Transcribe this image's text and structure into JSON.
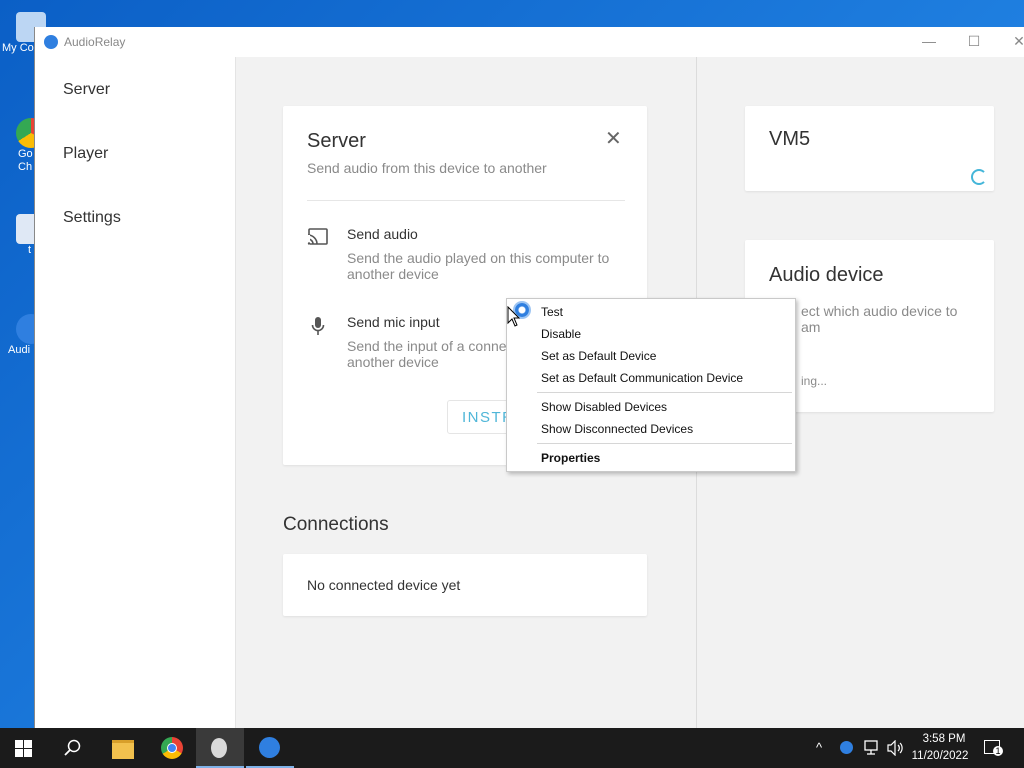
{
  "desktop": {
    "icons": [
      {
        "label": "My Co",
        "name": "my-computer-icon"
      },
      {
        "label": "Go Ch",
        "name": "chrome-desktop-icon"
      },
      {
        "label": "t",
        "name": "file-desktop-icon"
      },
      {
        "label": "Audi",
        "name": "audiorelay-desktop-icon"
      }
    ]
  },
  "window": {
    "title": "AudioRelay",
    "minimize_icon": "—",
    "maximize_icon": "☐",
    "close_icon": "✕"
  },
  "sidebar": {
    "items": [
      {
        "label": "Server"
      },
      {
        "label": "Player"
      },
      {
        "label": "Settings"
      }
    ]
  },
  "server_card": {
    "title": "Server",
    "subtitle": "Send audio from this device to another",
    "close_icon": "✕",
    "send_audio": {
      "title": "Send audio",
      "desc_line1": "Send the audio played on this computer to",
      "desc_line2": "another device"
    },
    "send_mic": {
      "title": "Send mic input",
      "desc_line1": "Send the input of a conne",
      "desc_line2": "another device"
    },
    "button_label": "INSTR"
  },
  "connections": {
    "heading": "Connections",
    "empty_text": "No connected device yet"
  },
  "vm_card": {
    "title": "VM5"
  },
  "audio_device_card": {
    "title": "Audio device",
    "desc_line1": "ect which audio device to",
    "desc_line2": "am",
    "status": "ing..."
  },
  "context_menu": {
    "items": [
      {
        "label": "Test",
        "bold": false
      },
      {
        "label": "Disable",
        "bold": false
      },
      {
        "label": "Set as Default Device",
        "bold": false
      },
      {
        "label": "Set as Default Communication Device",
        "bold": false
      },
      {
        "label": "Show Disabled Devices",
        "bold": false
      },
      {
        "label": "Show Disconnected Devices",
        "bold": false
      },
      {
        "label": "Properties",
        "bold": true
      }
    ]
  },
  "taskbar": {
    "time": "3:58 PM",
    "date": "11/20/2022",
    "notification_count": "1"
  },
  "colors": {
    "accent": "#4fb6d8",
    "desktop_blue": "#0b5fc6",
    "taskbar": "#1b1b1b"
  }
}
